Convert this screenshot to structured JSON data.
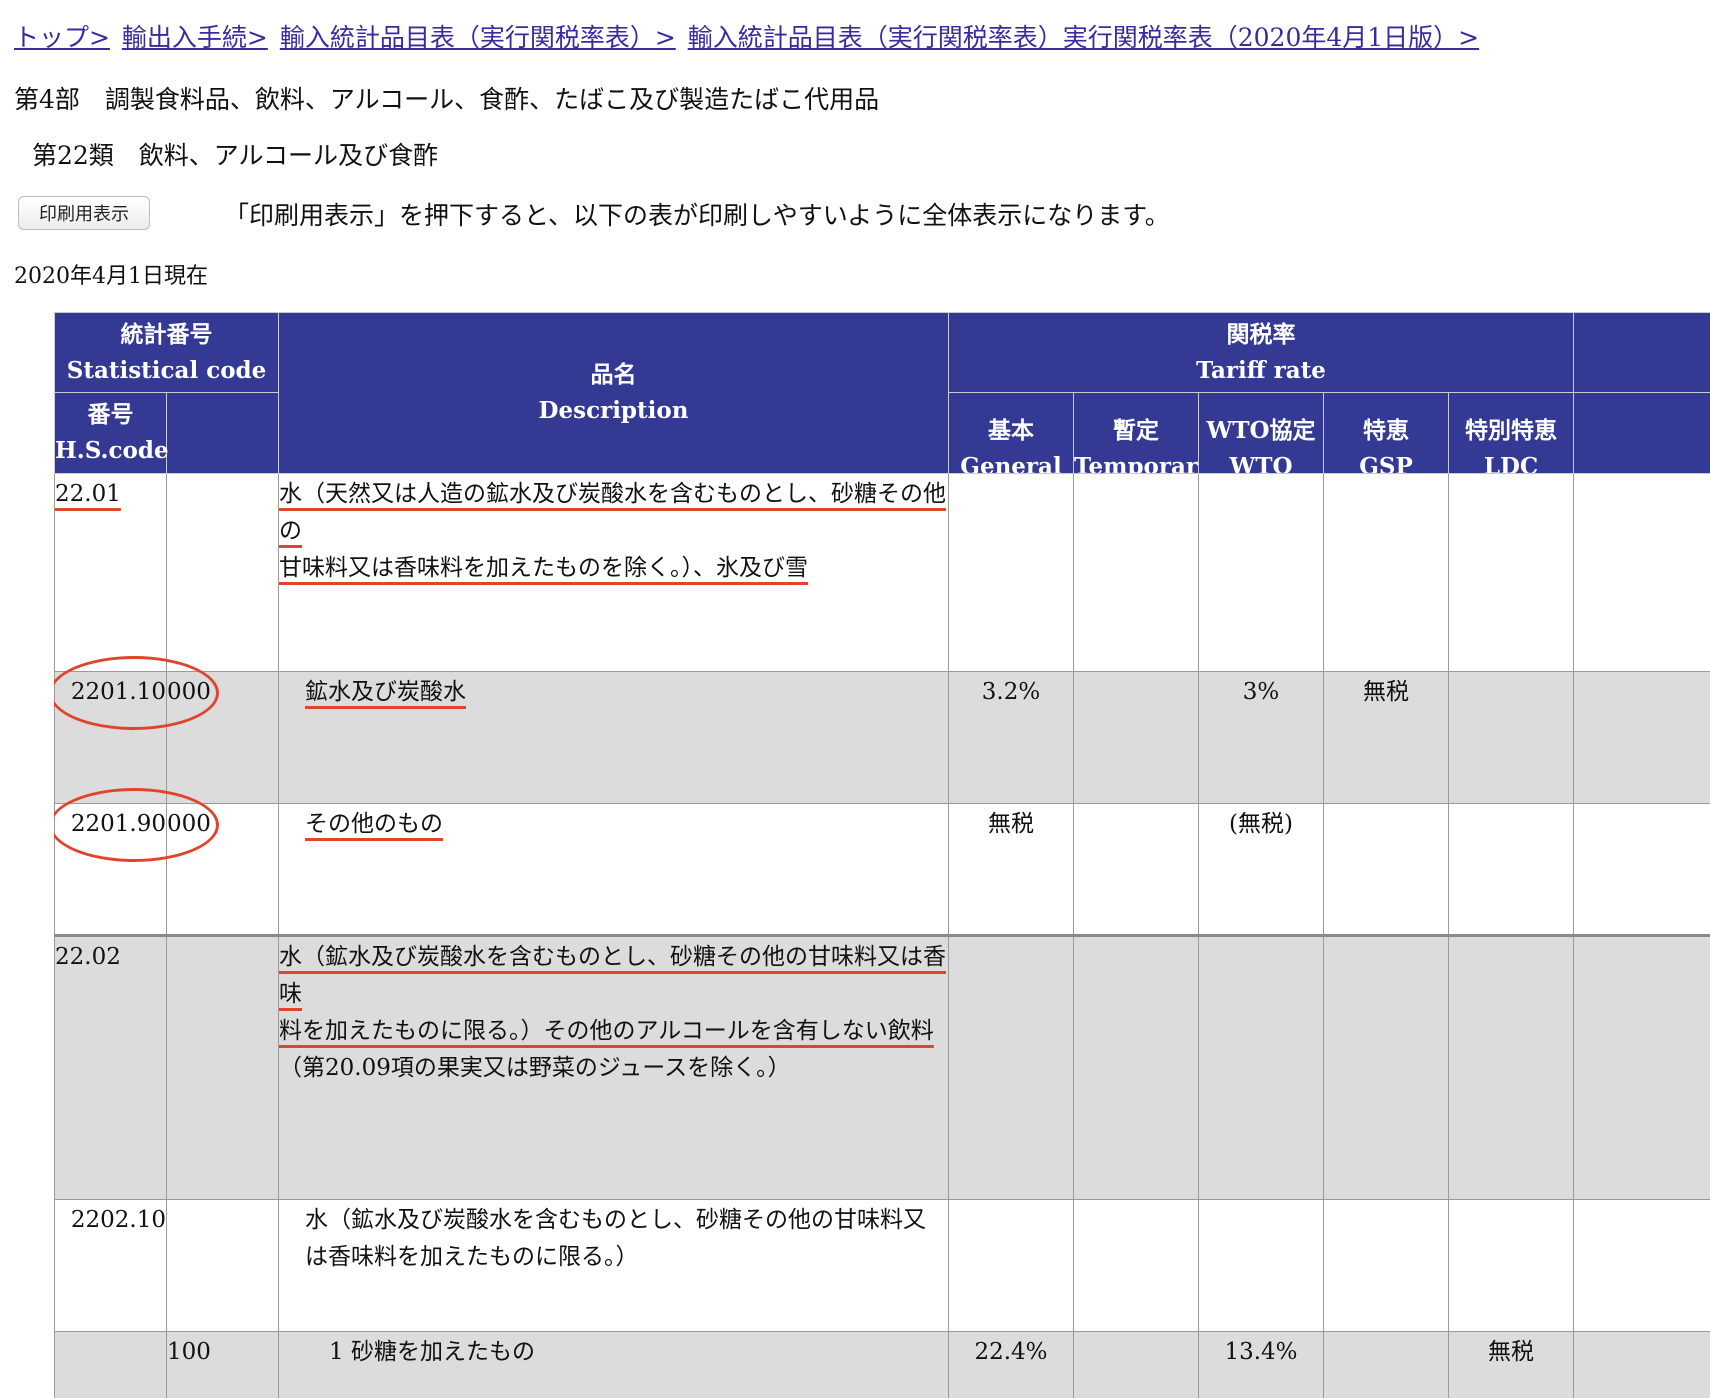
{
  "breadcrumb": {
    "items": [
      {
        "label": "トップ>"
      },
      {
        "label": "輸出入手続>"
      },
      {
        "label": "輸入統計品目表（実行関税率表）>"
      },
      {
        "label": "輸入統計品目表（実行関税率表）実行関税率表（2020年4月1日版）>"
      }
    ]
  },
  "section_title": "第4部　調製食料品、飲料、アルコール、食酢、たばこ及び製造たばこ代用品",
  "chapter_title": "第22類　飲料、アルコール及び食酢",
  "print_button_label": "印刷用表示",
  "print_note": "「印刷用表示」を押下すると、以下の表が印刷しやすいように全体表示になります。",
  "as_of": "2020年4月1日現在",
  "table": {
    "header": {
      "stat_code": "統計番号",
      "stat_code_en": "Statistical code",
      "hs_code": "番号",
      "hs_code_en": "H.S.code",
      "description": "品名",
      "description_en": "Description",
      "tariff_rate": "関税率",
      "tariff_rate_en": "Tariff rate",
      "columns": [
        {
          "ja": "基本",
          "en": "General"
        },
        {
          "ja": "暫定",
          "en": "Temporary"
        },
        {
          "ja": "WTO協定",
          "en": "WTO"
        },
        {
          "ja": "特恵",
          "en": "GSP"
        },
        {
          "ja": "特別特恵",
          "en": "LDC"
        }
      ]
    },
    "rows": [
      {
        "hs": "22.01",
        "stat": "",
        "desc_line1": "水（天然又は人造の鉱水及び炭酸水を含むものとし、砂糖その他の",
        "desc_line2": "甘味料又は香味料を加えたものを除く。）、氷及び雪",
        "general": "",
        "temporary": "",
        "wto": "",
        "gsp": "",
        "ldc": ""
      },
      {
        "hs": "2201.10",
        "stat": "000",
        "desc": "鉱水及び炭酸水",
        "general": "3.2%",
        "temporary": "",
        "wto": "3%",
        "gsp": "無税",
        "ldc": ""
      },
      {
        "hs": "2201.90",
        "stat": "000",
        "desc": "その他のもの",
        "general": "無税",
        "temporary": "",
        "wto": "(無税)",
        "gsp": "",
        "ldc": ""
      },
      {
        "hs": "22.02",
        "stat": "",
        "desc_line1": "水（鉱水及び炭酸水を含むものとし、砂糖その他の甘味料又は香味",
        "desc_line2": "料を加えたものに限る。）その他のアルコールを含有しない飲料",
        "desc_line3": "（第20.09項の果実又は野菜のジュースを除く。）",
        "general": "",
        "temporary": "",
        "wto": "",
        "gsp": "",
        "ldc": ""
      },
      {
        "hs": "2202.10",
        "stat": "",
        "desc": "水（鉱水及び炭酸水を含むものとし、砂糖その他の甘味料又は香味料を加えたものに限る。）",
        "general": "",
        "temporary": "",
        "wto": "",
        "gsp": "",
        "ldc": ""
      },
      {
        "hs": "",
        "stat": "100",
        "desc": "1 砂糖を加えたもの",
        "general": "22.4%",
        "temporary": "",
        "wto": "13.4%",
        "gsp": "",
        "ldc": "無税"
      }
    ]
  },
  "colors": {
    "header_bg": "#343a94",
    "link": "#3a2aa0",
    "annotation": "#e0452c",
    "row_gray": "#dcdcdc"
  }
}
